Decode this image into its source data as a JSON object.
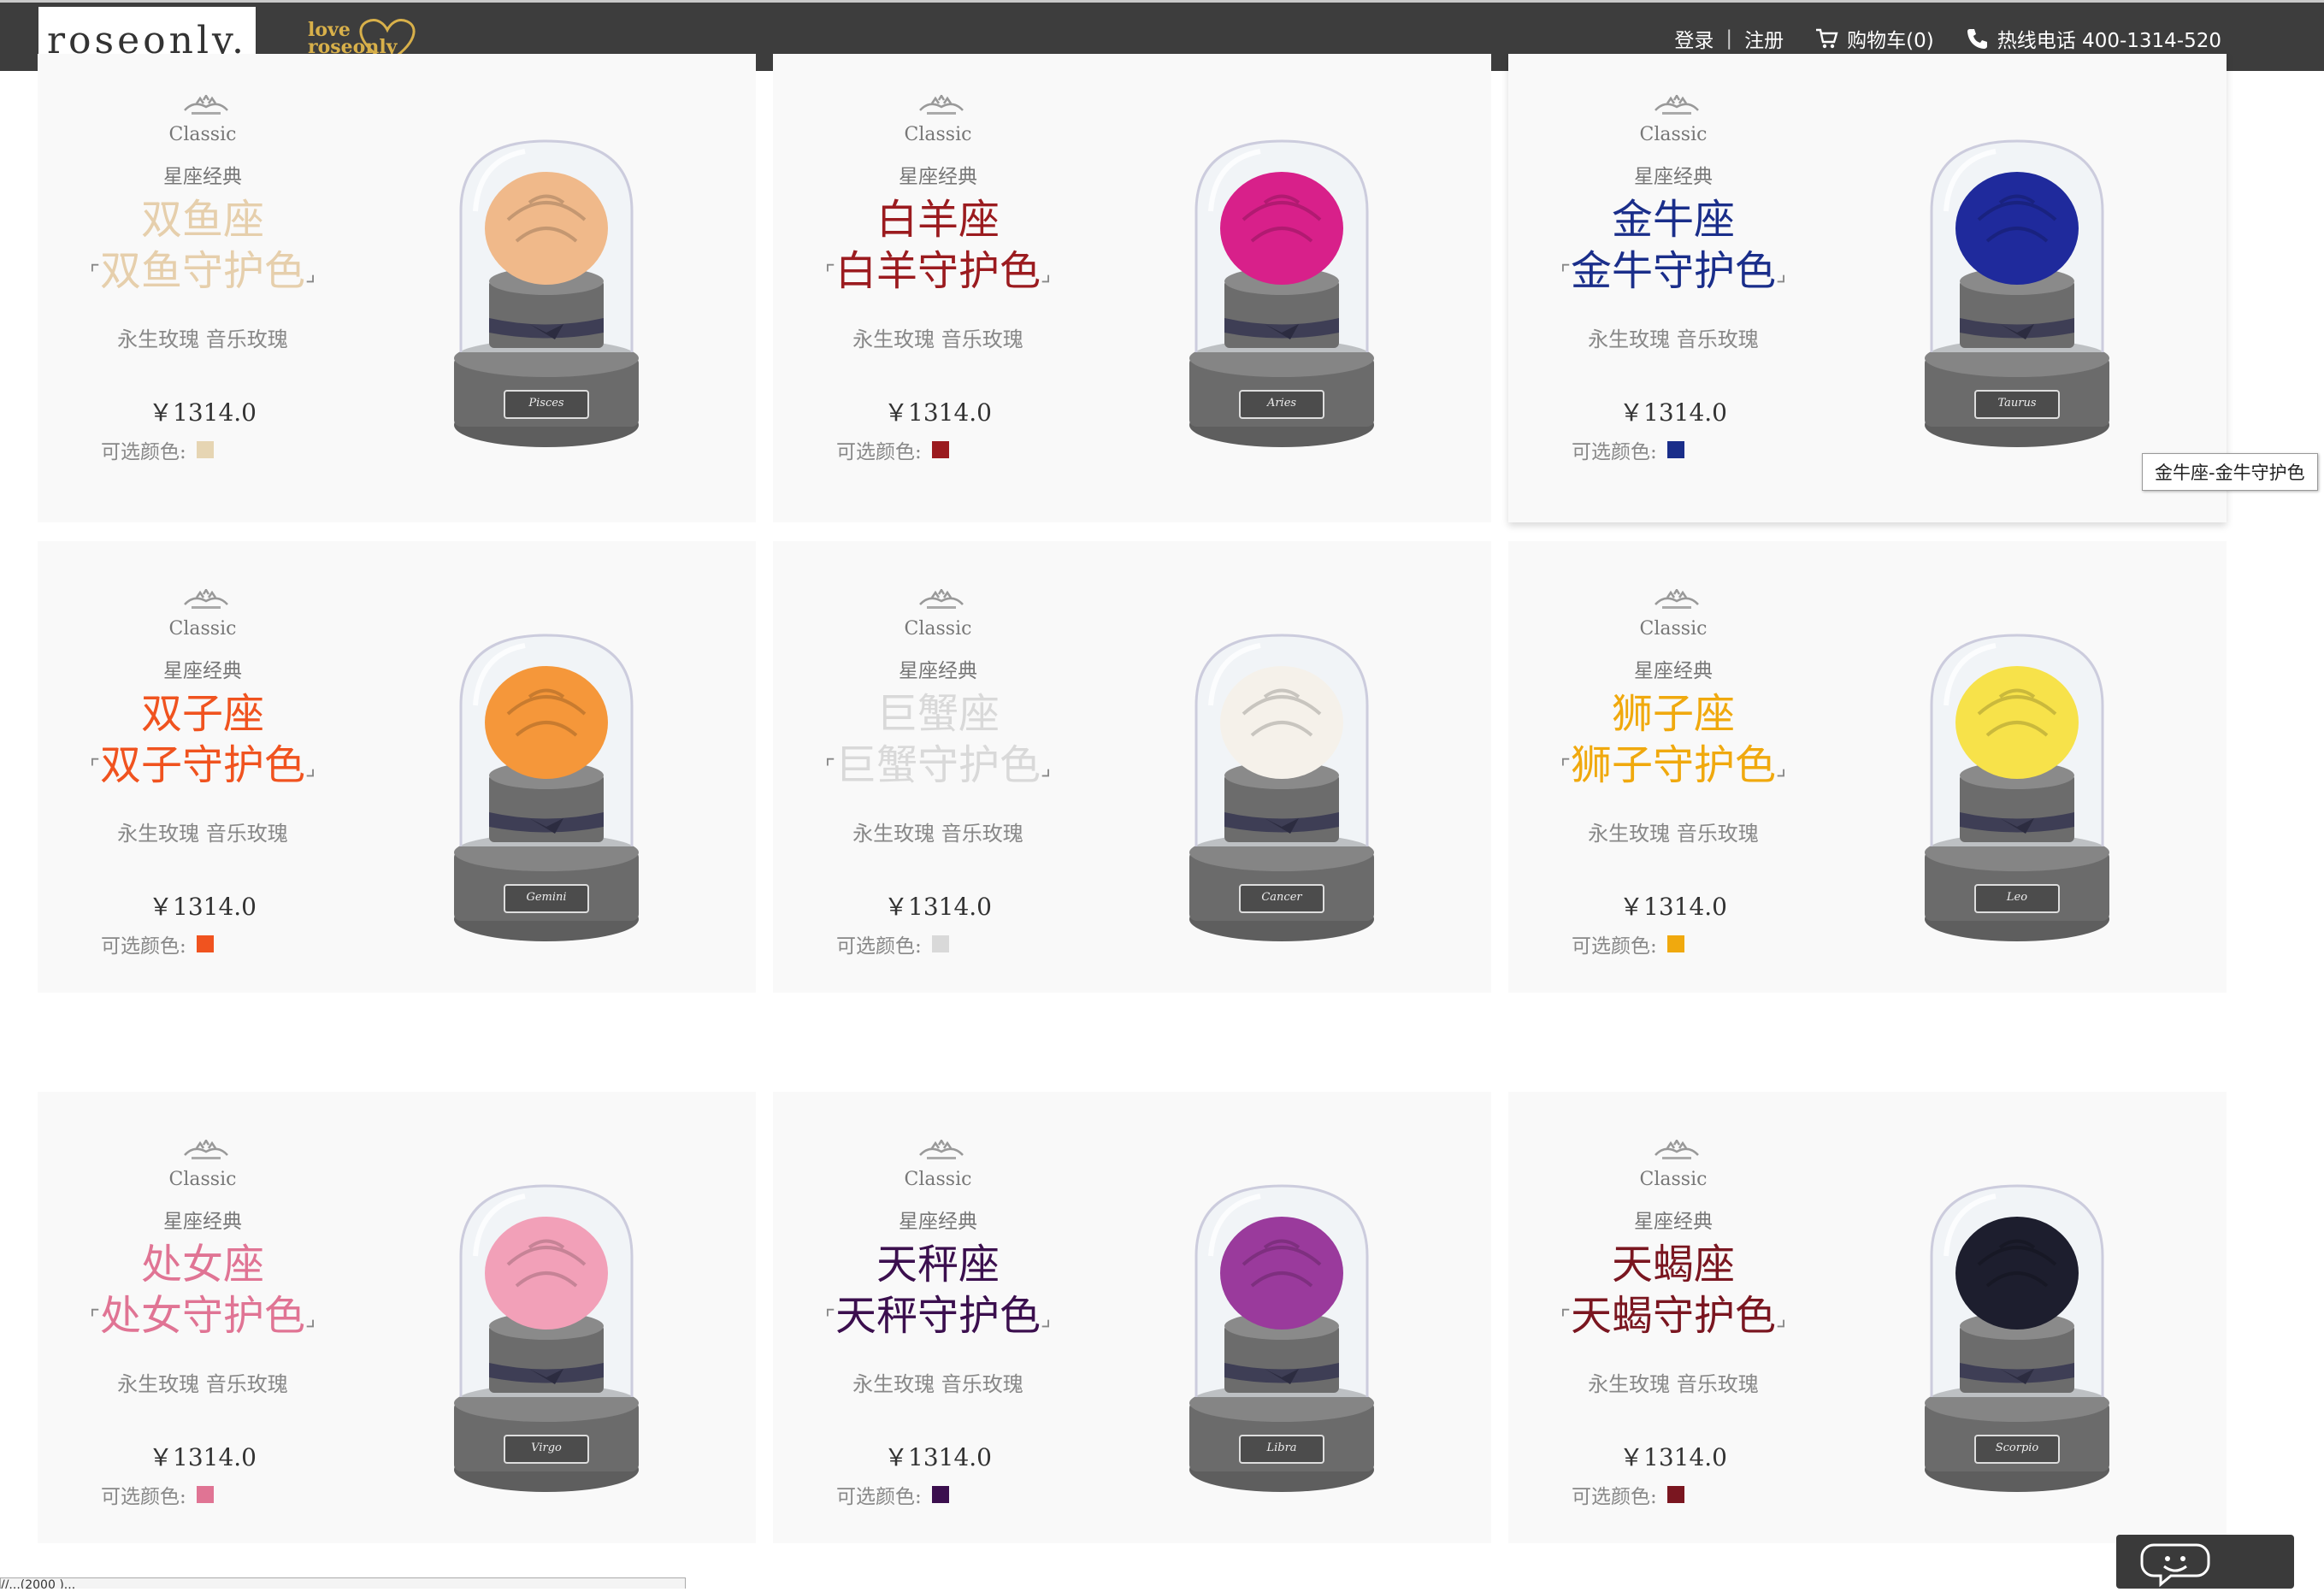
{
  "header": {
    "logo": "roseonly.",
    "slogan_line1": "love",
    "slogan_line2": "roseonly",
    "login": "登录",
    "sep": "|",
    "register": "注册",
    "cart": "购物车(0)",
    "hotline": "热线电话 400-1314-520"
  },
  "products": [
    {
      "classic": "Classic",
      "series": "星座经典",
      "sign": "双鱼座",
      "guard": "双鱼守护色",
      "sub": "永生玫瑰 音乐玫瑰",
      "price": "￥1314.0",
      "color_label": "可选颜色:",
      "color": "#e6d5b3",
      "rose": "#f0b98a",
      "plaque": "Pisces"
    },
    {
      "classic": "Classic",
      "series": "星座经典",
      "sign": "白羊座",
      "guard": "白羊守护色",
      "sub": "永生玫瑰 音乐玫瑰",
      "price": "￥1314.0",
      "color_label": "可选颜色:",
      "color": "#9b1b1f",
      "rose": "#d8208a",
      "plaque": "Aries"
    },
    {
      "classic": "Classic",
      "series": "星座经典",
      "sign": "金牛座",
      "guard": "金牛守护色",
      "sub": "永生玫瑰 音乐玫瑰",
      "price": "￥1314.0",
      "color_label": "可选颜色:",
      "color": "#1a2e8a",
      "rose": "#1f2a9c",
      "plaque": "Taurus"
    },
    {
      "classic": "Classic",
      "series": "星座经典",
      "sign": "双子座",
      "guard": "双子守护色",
      "sub": "永生玫瑰 音乐玫瑰",
      "price": "￥1314.0",
      "color_label": "可选颜色:",
      "color": "#f0531f",
      "rose": "#f5973a",
      "plaque": "Gemini"
    },
    {
      "classic": "Classic",
      "series": "星座经典",
      "sign": "巨蟹座",
      "guard": "巨蟹守护色",
      "sub": "永生玫瑰 音乐玫瑰",
      "price": "￥1314.0",
      "color_label": "可选颜色:",
      "color": "#d9d9d9",
      "rose": "#f5f1ea",
      "plaque": "Cancer"
    },
    {
      "classic": "Classic",
      "series": "星座经典",
      "sign": "狮子座",
      "guard": "狮子守护色",
      "sub": "永生玫瑰 音乐玫瑰",
      "price": "￥1314.0",
      "color_label": "可选颜色:",
      "color": "#f0a90e",
      "rose": "#f7e24a",
      "plaque": "Leo"
    },
    {
      "classic": "Classic",
      "series": "星座经典",
      "sign": "处女座",
      "guard": "处女守护色",
      "sub": "永生玫瑰 音乐玫瑰",
      "price": "￥1314.0",
      "color_label": "可选颜色:",
      "color": "#e07494",
      "rose": "#f2a0b8",
      "plaque": "Virgo"
    },
    {
      "classic": "Classic",
      "series": "星座经典",
      "sign": "天秤座",
      "guard": "天秤守护色",
      "sub": "永生玫瑰 音乐玫瑰",
      "price": "￥1314.0",
      "color_label": "可选颜色:",
      "color": "#3b0f4e",
      "rose": "#9a3a9c",
      "plaque": "Libra"
    },
    {
      "classic": "Classic",
      "series": "星座经典",
      "sign": "天蝎座",
      "guard": "天蝎守护色",
      "sub": "永生玫瑰 音乐玫瑰",
      "price": "￥1314.0",
      "color_label": "可选颜色:",
      "color": "#7a1620",
      "rose": "#1d1e2e",
      "plaque": "Scorpio"
    }
  ],
  "tooltip": "金牛座-金牛守护色",
  "status_url": "//...(2000 )..."
}
